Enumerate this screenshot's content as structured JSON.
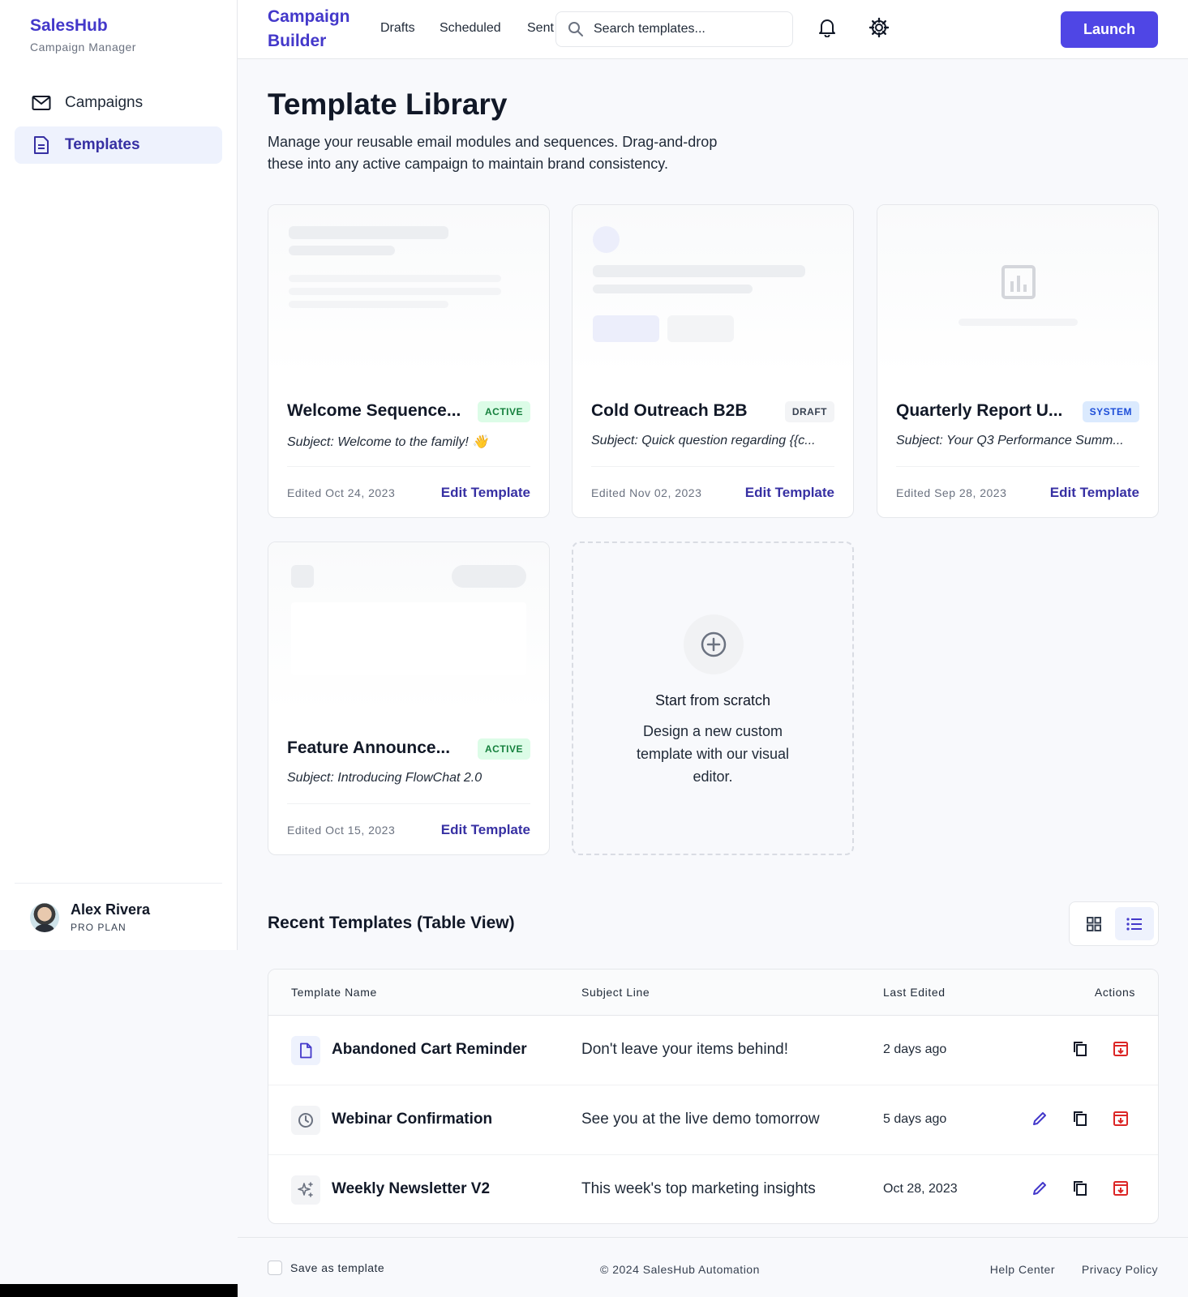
{
  "sidebar": {
    "brand": "SalesHub",
    "brand_sub": "Campaign Manager",
    "items": [
      {
        "label": "Campaigns",
        "icon": "mail-icon",
        "active": false
      },
      {
        "label": "Templates",
        "icon": "document-icon",
        "active": true
      }
    ],
    "user": {
      "name": "Alex Rivera",
      "plan": "PRO PLAN"
    }
  },
  "header": {
    "title": "Campaign Builder",
    "tabs": [
      "Drafts",
      "Scheduled",
      "Sent"
    ],
    "search_placeholder": "Search templates...",
    "launch_label": "Launch"
  },
  "main": {
    "title": "Template Library",
    "description": "Manage your reusable email modules and sequences. Drag-and-drop these into any active campaign to maintain brand consistency.",
    "cards": [
      {
        "title": "Welcome Sequence...",
        "status": "ACTIVE",
        "subject": "Subject: Welcome to the family! 👋",
        "edited": "Edited Oct 24, 2023",
        "action": "Edit Template"
      },
      {
        "title": "Cold Outreach B2B",
        "status": "DRAFT",
        "subject": "Subject: Quick question regarding {{c...",
        "edited": "Edited Nov 02, 2023",
        "action": "Edit Template"
      },
      {
        "title": "Quarterly Report U...",
        "status": "SYSTEM",
        "subject": "Subject: Your Q3 Performance Summ...",
        "edited": "Edited Sep 28, 2023",
        "action": "Edit Template"
      },
      {
        "title": "Feature Announce...",
        "status": "ACTIVE",
        "subject": "Subject: Introducing FlowChat 2.0",
        "edited": "Edited Oct 15, 2023",
        "action": "Edit Template"
      }
    ],
    "scratch": {
      "title": "Start from scratch",
      "description": "Design a new custom template with our visual editor."
    }
  },
  "table": {
    "title": "Recent Templates (Table View)",
    "columns": [
      "Template Name",
      "Subject Line",
      "Last Edited",
      "Actions"
    ],
    "rows": [
      {
        "name": "Abandoned Cart Reminder",
        "subject": "Don't leave your items behind!",
        "edited": "2 days ago",
        "icon": "document-icon"
      },
      {
        "name": "Webinar Confirmation",
        "subject": "See you at the live demo tomorrow",
        "edited": "5 days ago",
        "icon": "clock-icon"
      },
      {
        "name": "Weekly Newsletter V2",
        "subject": "This week's top marketing insights",
        "edited": "Oct 28, 2023",
        "icon": "sparkle-icon"
      }
    ]
  },
  "footer": {
    "save_label": "Save as template",
    "copyright": "© 2024 SalesHub Automation",
    "links": [
      "Help Center",
      "Privacy Policy"
    ]
  },
  "colors": {
    "accent": "#4f46e5",
    "brand": "#4338ca",
    "active_badge": "#15803d",
    "system_badge": "#1d4ed8",
    "danger": "#dc2626"
  }
}
